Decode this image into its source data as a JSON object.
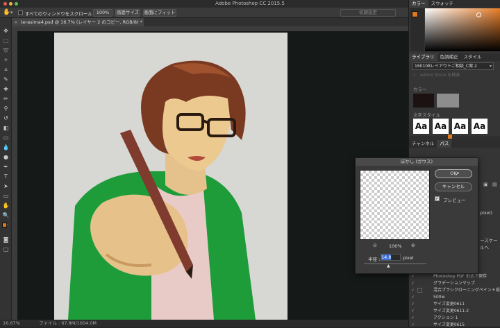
{
  "window": {
    "title": "Adobe Photoshop CC 2015.5"
  },
  "options_bar": {
    "scroll_all_label": "すべてのウィンドウをスクロール",
    "zoom_100": "100%",
    "fit_screen": "画面サイズ",
    "fill_screen": "画面にフィット",
    "workspace": "初期設定"
  },
  "document": {
    "tab_title": "terasima4.psd @ 16.7% (レイヤー 2 のコピー, RGB/8) *",
    "zoom": "16.67%",
    "file_info": "ファイル : 67.8M/1004.0M"
  },
  "panels": {
    "color_tabs": [
      "カラー",
      "スウォッチ"
    ],
    "library_tabs": [
      "ライブラリ",
      "色調補正",
      "スタイル"
    ],
    "library_select": "160108レイアウトご相談_C案 2",
    "library_search_placeholder": "Adobe Stock を検索",
    "colors_label": "カラー",
    "text_styles_label": "文字スタイル",
    "text_style_sample": "Aa",
    "channel_tabs": [
      "チャンネル",
      "パス"
    ],
    "partial_labels": [
      "pixel)",
      "ースケールへ"
    ]
  },
  "history": [
    {
      "label": "Photoshop PDF 形式で保存",
      "has_box": false
    },
    {
      "label": "グラデーションマップ",
      "has_box": false
    },
    {
      "label": "混合ブラシクローニングペイント設定",
      "has_box": true
    },
    {
      "label": "500w",
      "has_box": false
    },
    {
      "label": "サイズ変更0611",
      "has_box": false
    },
    {
      "label": "サイズ変更0611-2",
      "has_box": false
    },
    {
      "label": "アクション 1",
      "has_box": false
    },
    {
      "label": "サイズ変更0615",
      "has_box": false
    }
  ],
  "dialog": {
    "title": "ぼかし (ガウス)",
    "ok": "OK",
    "cancel": "キャンセル",
    "preview_label": "プレビュー",
    "preview_checked": true,
    "zoom": "100%",
    "radius_label": "半径 :",
    "radius_value": "14.8",
    "radius_unit": "pixel"
  },
  "colors": {
    "foreground": "#e07a22",
    "background": "#ffffff",
    "swatch_dark": "#1c1212",
    "swatch_gray": "#8d8d8d"
  }
}
